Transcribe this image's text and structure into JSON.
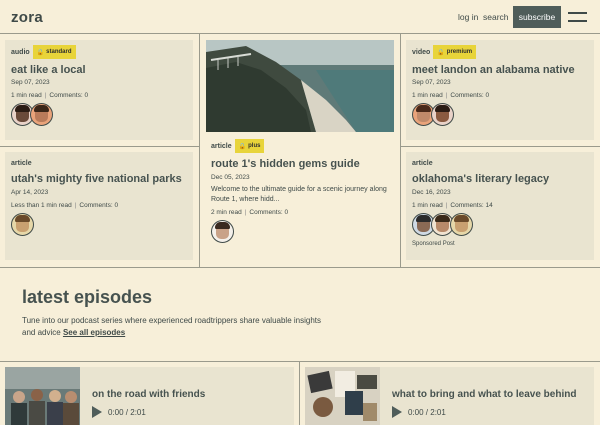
{
  "header": {
    "logo": "zora",
    "login": "log in",
    "search": "search",
    "subscribe": "subscribe"
  },
  "cards": [
    {
      "type": "audio",
      "badge": "standard",
      "title": "eat like a local",
      "date": "Sep 07, 2023",
      "read": "1 min read",
      "comments": "Comments: 0"
    },
    {
      "type": "article",
      "badge": "plus",
      "title": "route 1's hidden gems guide",
      "date": "Dec 05, 2023",
      "desc": "Welcome to the ultimate guide for a scenic journey along Route 1, where hidd...",
      "read": "2 min read",
      "comments": "Comments: 0"
    },
    {
      "type": "video",
      "badge": "premium",
      "title": "meet landon an alabama native",
      "date": "Sep 07, 2023",
      "read": "1 min read",
      "comments": "Comments: 0"
    },
    {
      "type": "article",
      "title": "utah's mighty five national parks",
      "date": "Apr 14, 2023",
      "read": "Less than 1 min read",
      "comments": "Comments: 0"
    },
    {
      "type": "article",
      "title": "oklahoma's literary legacy",
      "date": "Dec 16, 2023",
      "read": "1 min read",
      "comments": "Comments: 14",
      "sponsored": "Sponsored Post"
    }
  ],
  "episodes": {
    "title": "latest episodes",
    "desc": "Tune into our podcast series where experienced roadtrippers share valuable insights and advice",
    "link": "See all episodes",
    "items": [
      {
        "title": "on the road with friends",
        "time": "0:00 / 2:01"
      },
      {
        "title": "what to bring and what to leave behind",
        "time": "0:00 / 2:01"
      }
    ]
  },
  "colors": {
    "badge": "#e8d43a",
    "accent": "#4f5d5a",
    "background": "#f7efd9",
    "card": "#e9e4d0"
  },
  "icons": [
    "lock-icon",
    "menu-icon",
    "play-icon"
  ]
}
